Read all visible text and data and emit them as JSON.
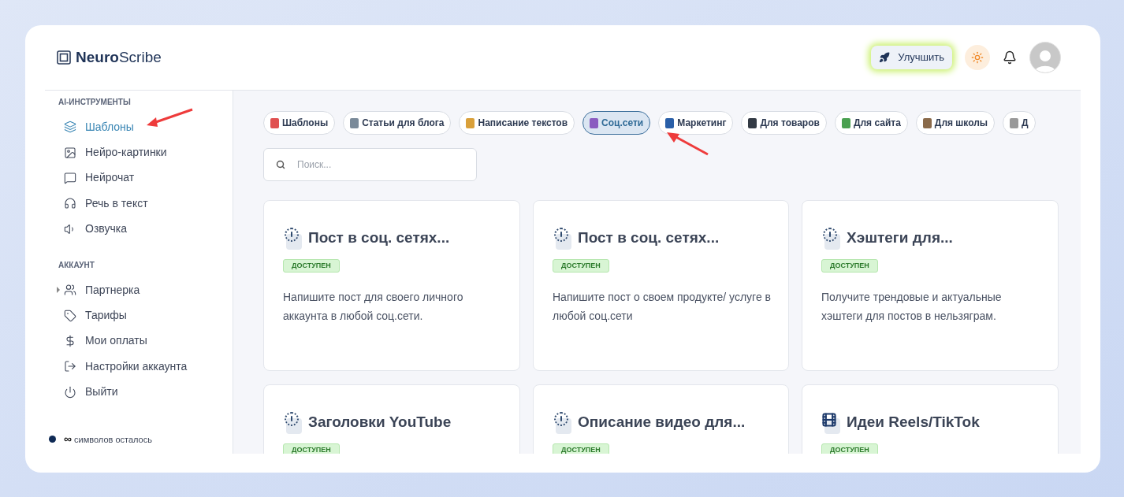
{
  "brand": {
    "bold": "Neuro",
    "rest": "Scribe"
  },
  "header": {
    "upgrade": "Улучшить"
  },
  "sidebar": {
    "sections": [
      {
        "title": "AI-ИНСТРУМЕНТЫ",
        "items": [
          {
            "label": "Шаблоны",
            "selected": true,
            "expandable": false
          },
          {
            "label": "Нейро-картинки",
            "selected": false,
            "expandable": false
          },
          {
            "label": "Нейрочат",
            "selected": false,
            "expandable": false
          },
          {
            "label": "Речь в текст",
            "selected": false,
            "expandable": false
          },
          {
            "label": "Озвучка",
            "selected": false,
            "expandable": false
          }
        ]
      },
      {
        "title": "АККАУНТ",
        "items": [
          {
            "label": "Партнерка",
            "selected": false,
            "expandable": true
          },
          {
            "label": "Тарифы",
            "selected": false,
            "expandable": false
          },
          {
            "label": "Мои оплаты",
            "selected": false,
            "expandable": false
          },
          {
            "label": "Настройки аккаунта",
            "selected": false,
            "expandable": false
          },
          {
            "label": "Выйти",
            "selected": false,
            "expandable": false
          }
        ]
      }
    ],
    "footer": {
      "symbol": "∞",
      "text": "символов осталось"
    }
  },
  "categories": [
    {
      "label": "Шаблоны",
      "selected": false,
      "color": "#e05050"
    },
    {
      "label": "Статьи для блога",
      "selected": false,
      "color": "#7a8a99"
    },
    {
      "label": "Написание текстов",
      "selected": false,
      "color": "#d9a03a"
    },
    {
      "label": "Соц.сети",
      "selected": true,
      "color": "#8a5cc0"
    },
    {
      "label": "Маркетинг",
      "selected": false,
      "color": "#2a5fa8"
    },
    {
      "label": "Для товаров",
      "selected": false,
      "color": "#333a44"
    },
    {
      "label": "Для сайта",
      "selected": false,
      "color": "#4aa050"
    },
    {
      "label": "Для школы",
      "selected": false,
      "color": "#8a6a4a"
    },
    {
      "label": "Д",
      "selected": false,
      "color": "#999999"
    }
  ],
  "search": {
    "placeholder": "Поиск..."
  },
  "cards": [
    {
      "title": "Пост в соц. сетях...",
      "kind": "alert",
      "badge": "ДОСТУПЕН",
      "description": "Напишите пост для своего личного аккаунта в любой соц.сети."
    },
    {
      "title": "Пост в соц. сетях...",
      "kind": "alert",
      "badge": "ДОСТУПЕН",
      "description": "Напишите пост о своем продукте/ услуге в любой соц.сети"
    },
    {
      "title": "Хэштеги для...",
      "kind": "alert",
      "badge": "ДОСТУПЕН",
      "description": "Получите трендовые и актуальные хэштеги для постов в нельзяграм."
    },
    {
      "title": "Заголовки YouTube",
      "kind": "alert",
      "badge": "ДОСТУПЕН"
    },
    {
      "title": "Описание видео для...",
      "kind": "alert",
      "badge": "ДОСТУПЕН"
    },
    {
      "title": "Идеи Reels/TikTok",
      "kind": "film",
      "badge": "ДОСТУПЕН"
    }
  ]
}
